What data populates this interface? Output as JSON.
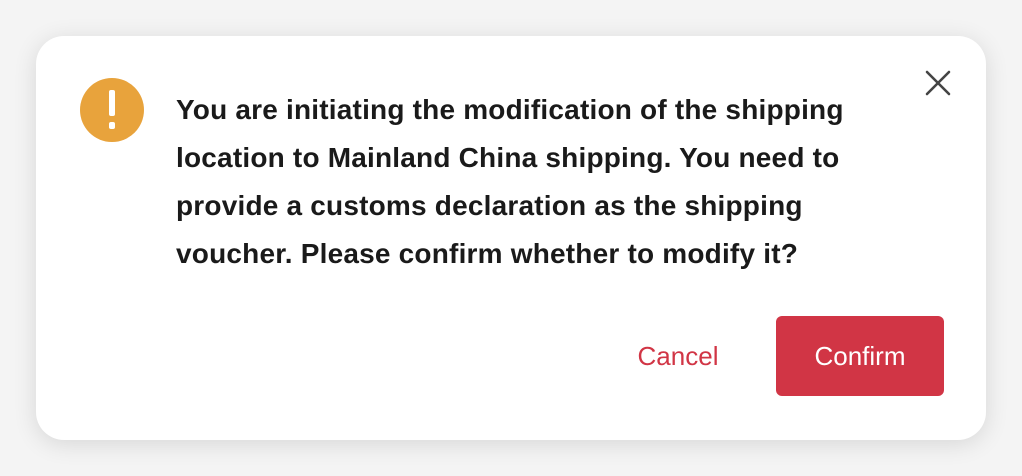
{
  "dialog": {
    "message": "You are initiating the modification of the shipping location to Mainland China shipping. You need to provide a customs declaration as the shipping voucher. Please confirm whether to modify it?",
    "icon": "warning-icon",
    "close_icon": "close-icon",
    "cancel_label": "Cancel",
    "confirm_label": "Confirm"
  },
  "colors": {
    "warning": "#e8a33c",
    "accent": "#d13545",
    "text": "#1a1a1a"
  }
}
